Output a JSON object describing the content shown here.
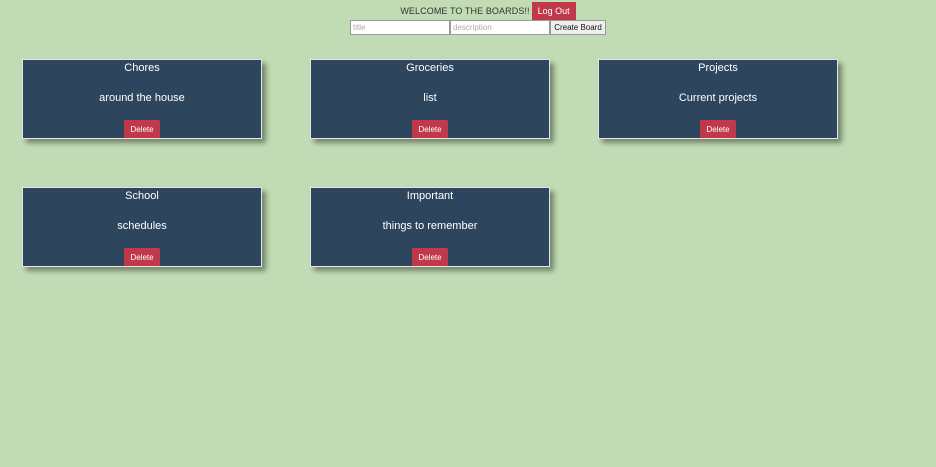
{
  "header": {
    "welcome_text": "WELCOME TO THE BOARDS!!",
    "logout_label": "Log Out"
  },
  "create_form": {
    "title_placeholder": "title",
    "description_placeholder": "description",
    "create_label": "Create Board"
  },
  "boards": [
    {
      "title": "Chores",
      "description": "around the house",
      "delete_label": "Delete"
    },
    {
      "title": "Groceries",
      "description": "list",
      "delete_label": "Delete"
    },
    {
      "title": "Projects",
      "description": "Current projects",
      "delete_label": "Delete"
    },
    {
      "title": "School",
      "description": "schedules",
      "delete_label": "Delete"
    },
    {
      "title": "Important",
      "description": "things to remember",
      "delete_label": "Delete"
    }
  ],
  "colors": {
    "background": "#c1dcb4",
    "card": "#2d465e",
    "danger": "#c0394b"
  }
}
